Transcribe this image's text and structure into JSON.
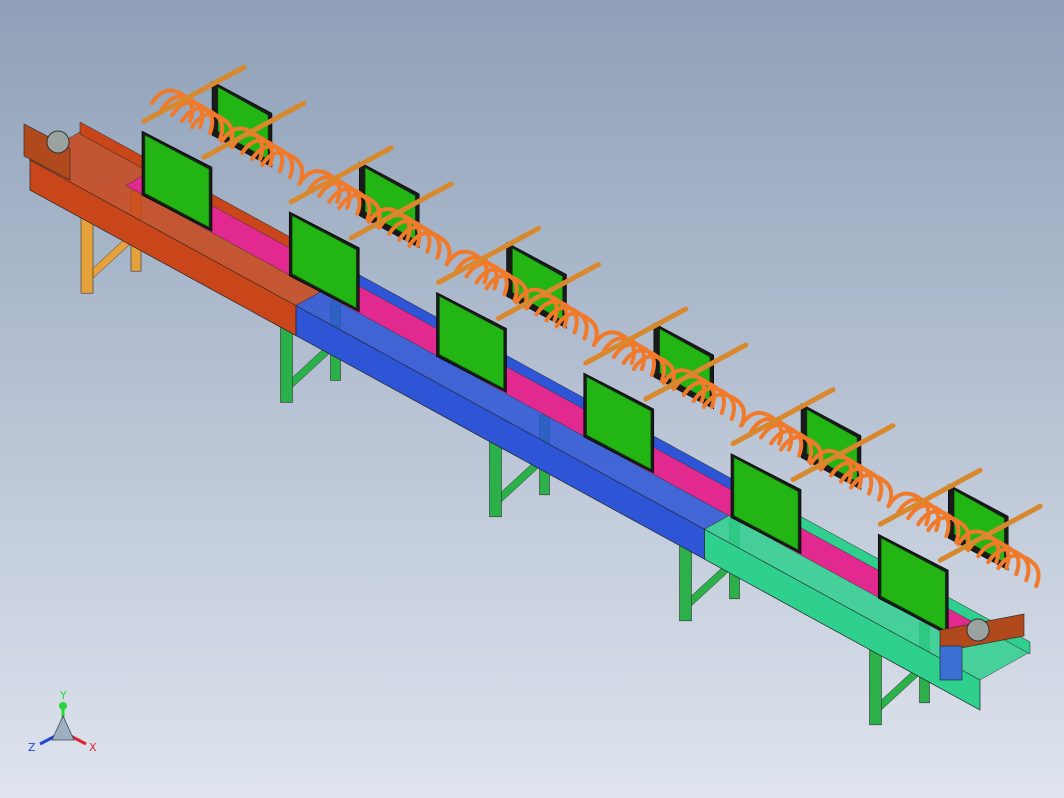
{
  "viewport": {
    "background_top": "#8ea0b8",
    "background_bottom": "#dfe4ee"
  },
  "model": {
    "frame_colors": [
      "#c9461a",
      "#2d55d6",
      "#2fcf8e"
    ],
    "leg_colors": [
      "#e6a23a",
      "#2bb04a",
      "#2bb04a",
      "#2bb04a",
      "#2bb04a"
    ],
    "heater_box_color": "#22b514",
    "heater_box_dark": "#1a1a1a",
    "coil_color": "#f07a2a",
    "rod_color": "#d9892d",
    "inner_bed_color": "#e2298f",
    "end_cap_color": "#b04a1c",
    "module_count": 6
  },
  "triad": {
    "y_label": "Y",
    "x_label": "X",
    "z_label": "Z",
    "y_color": "#2bd43b",
    "x_color": "#e0242a",
    "z_color": "#2743d8"
  }
}
